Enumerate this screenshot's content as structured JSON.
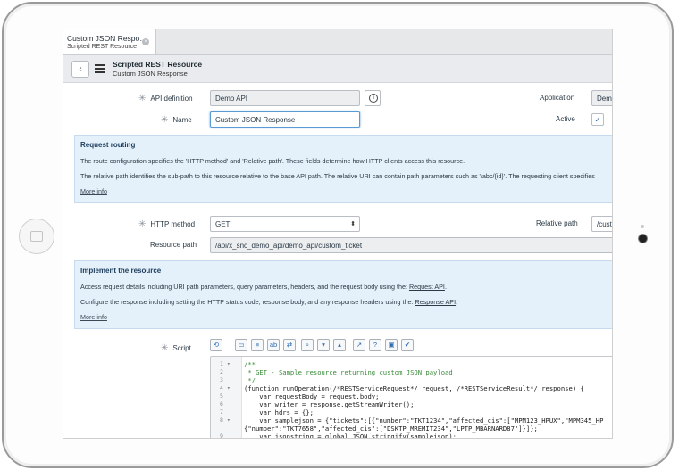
{
  "tab": {
    "title": "Custom JSON Respo…",
    "subtitle": "Scripted REST Resource",
    "close": "×"
  },
  "header": {
    "back": "‹",
    "title": "Scripted REST Resource",
    "subtitle": "Custom JSON Response"
  },
  "form": {
    "api_definition_label": "API definition",
    "api_definition_value": "Demo API",
    "application_label": "Application",
    "application_value": "Demo API",
    "name_label": "Name",
    "name_value": "Custom JSON Response",
    "active_label": "Active",
    "active_check": "✓",
    "required_mark": "✳",
    "info_glyph": "i"
  },
  "routing": {
    "title": "Request routing",
    "line1": "The route configuration specifies the 'HTTP method' and 'Relative path'. These fields determine how HTTP clients access this resource.",
    "line2": "The relative path identifies the sub-path to this resource relative to the base API path. The relative URI can contain path parameters such as '/abc/{id}'. The requesting client specifies",
    "more": "More info"
  },
  "http": {
    "method_label": "HTTP method",
    "method_value": "GET",
    "method_arrow": "⬍",
    "relative_label": "Relative path",
    "relative_value": "/custom_ticket",
    "resource_label": "Resource path",
    "resource_value": "/api/x_snc_demo_api/demo_api/custom_ticket"
  },
  "implement": {
    "title": "Implement the resource",
    "line1_prefix": "Access request details including URI path parameters, query parameters, headers, and the request body using the: ",
    "line1_link": "Request API",
    "line1_suffix": ".",
    "line2_prefix": "Configure the response including setting the HTTP status code, response body, and any response headers using the: ",
    "line2_link": "Response API",
    "line2_suffix": ".",
    "more": "More info"
  },
  "script": {
    "label": "Script",
    "toolbar_icons": [
      "toggle-icon",
      "comment-icon",
      "format-icon",
      "replace-icon",
      "replace-all-icon",
      "search-icon",
      "chevron-down-icon",
      "chevron-up-icon",
      "fullscreen-icon",
      "help-icon",
      "save-icon",
      "syntax-check-icon"
    ],
    "toolbar_glyphs": [
      "⟲",
      "▭",
      "≡",
      "ab",
      "⇄",
      "⌕",
      "▾",
      "▴",
      "↗",
      "?",
      "▣",
      "✔"
    ],
    "line_numbers": [
      "1 ▾",
      "2",
      "3",
      "4 ▾",
      "5",
      "6",
      "7",
      "8 ▾",
      "",
      "9"
    ],
    "code_lines": [
      "/**",
      " * GET - Sample resource returning custom JSON payload",
      " */",
      "(function runOperation(/*RESTServiceRequest*/ request, /*RESTServiceResult*/ response) {",
      "    var requestBody = request.body;",
      "    var writer = response.getStreamWriter();",
      "    var hdrs = {};",
      "    var samplejson = {\"tickets\":[{\"number\":\"TKT1234\",\"affected_cis\":[\"MPM123_HPUX\",\"MPM345_HP",
      "{\"number\":\"TKT7658\",\"affected_cis\":[\"DSKTP_MREMIT234\",\"LPTP_MBARNARD87\"]}]};",
      "    var jsonstring = global.JSON.stringify(samplejson);"
    ]
  }
}
